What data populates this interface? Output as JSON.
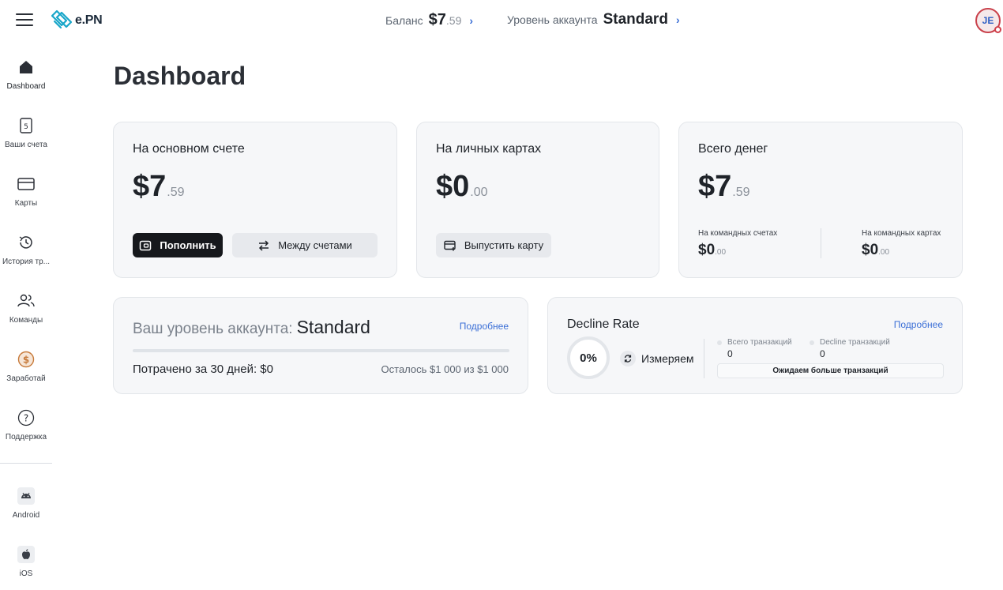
{
  "header": {
    "logo_text": "e.PN",
    "balance_label": "Баланс",
    "balance_int": "$7",
    "balance_dec": ".59",
    "level_label": "Уровень аккаунта",
    "level_value": "Standard",
    "avatar_initials": "JE"
  },
  "sidebar": {
    "items": [
      {
        "label": "Dashboard",
        "icon": "home-icon"
      },
      {
        "label": "Ваши счета",
        "icon": "accounts-icon"
      },
      {
        "label": "Карты",
        "icon": "card-icon"
      },
      {
        "label": "История тр...",
        "icon": "history-icon"
      },
      {
        "label": "Команды",
        "icon": "team-icon"
      },
      {
        "label": "Заработай",
        "icon": "earn-icon"
      },
      {
        "label": "Поддержка",
        "icon": "help-icon"
      },
      {
        "label": "Android",
        "icon": "android-icon"
      },
      {
        "label": "iOS",
        "icon": "apple-icon"
      }
    ]
  },
  "page": {
    "title": "Dashboard"
  },
  "cards": {
    "main": {
      "label": "На основном счете",
      "amount_int": "$7",
      "amount_dec": ".59",
      "topup_label": "Пополнить",
      "transfer_label": "Между счетами"
    },
    "personal": {
      "label": "На личных картах",
      "amount_int": "$0",
      "amount_dec": ".00",
      "issue_label": "Выпустить карту"
    },
    "total": {
      "label": "Всего денег",
      "amount_int": "$7",
      "amount_dec": ".59",
      "team_accounts_label": "На командных счетах",
      "team_accounts_int": "$0",
      "team_accounts_dec": ".00",
      "team_cards_label": "На командных картах",
      "team_cards_int": "$0",
      "team_cards_dec": ".00"
    }
  },
  "level": {
    "prefix": "Ваш уровень аккаунта:",
    "value": "Standard",
    "more_link": "Подробнее",
    "spent": "Потрачено за 30 дней: $0",
    "remaining": "Осталось $1 000 из $1 000",
    "progress_fraction": 0
  },
  "decline": {
    "title": "Decline Rate",
    "more_link": "Подробнее",
    "rate": "0%",
    "status": "Измеряем",
    "total_tx_label": "Всего транзакций",
    "total_tx_value": "0",
    "decline_tx_label": "Decline транзакций",
    "decline_tx_value": "0",
    "await_text": "Ожидаем больше транзакций"
  },
  "colors": {
    "accent": "#3b6fd6",
    "dark_button": "#16181c",
    "card_bg": "#f6f7f9",
    "logo": "#18a6c9"
  }
}
